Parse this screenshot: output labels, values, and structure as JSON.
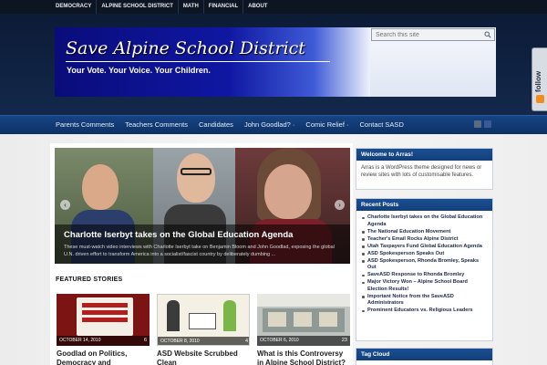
{
  "top_nav": [
    "DEMOCRACY",
    "ALPINE SCHOOL DISTRICT",
    "MATH",
    "FINANCIAL",
    "ABOUT"
  ],
  "banner": {
    "title": "Save Alpine School District",
    "subtitle": "Your Vote. Your Voice. Your Children."
  },
  "search": {
    "placeholder": "Search this site"
  },
  "follow": {
    "label": "follow"
  },
  "main_nav": [
    "Parents Comments",
    "Teachers Comments",
    "Candidates",
    "John Goodlad? ·",
    "Comic Relief ·",
    "Contact SASD"
  ],
  "slider": {
    "title": "Charlotte Iserbyt takes on the Global Education Agenda",
    "excerpt": "These must-watch video interviews with Charlotte Iserbyt take on Benjamin Bloom and John Goodlad, exposing the global U.N. driven effort to transform America into a socialist/fascist country by deliberately dumbing ..."
  },
  "featured": {
    "heading": "FEATURED STORIES",
    "cards": [
      {
        "title": "Goodlad on Politics, Democracy and Capitalism",
        "date": "OCTOBER 14, 2010",
        "count": "6"
      },
      {
        "title": "ASD Website Scrubbed Clean",
        "date": "OCTOBER 8, 2010",
        "count": "4"
      },
      {
        "title": "What is this Controversy in Alpine School District?",
        "date": "OCTOBER 6, 2010",
        "count": "23"
      }
    ]
  },
  "sidebar": {
    "welcome": {
      "title": "Welcome to Arras!",
      "text": "Arras is a WordPress theme designed for news or review sites with lots of customisable features."
    },
    "recent": {
      "title": "Recent Posts",
      "items": [
        "Charlotte Iserbyt takes on the Global Education Agenda",
        "The National Education Movement",
        "Teacher's Email Rocks Alpine District",
        "Utah Taxpayers Fund Global Education Agenda",
        "ASD Spokesperson Speaks Out",
        "ASD Spokesperson, Rhonda Bromley, Speaks Out",
        "SaveASD Response to Rhonda Bromley",
        "Major Victory Won – Alpine School Board Election Results!",
        "Important Notice from the SaveASD Administrators",
        "Prominent Educators vs. Religious Leaders"
      ]
    },
    "tagcloud": {
      "title": "Tag Cloud"
    }
  },
  "colors": {
    "nav_blue": "#164583",
    "banner_blue": "#0f17a2",
    "widget_header": "#1b4f92",
    "rss_orange": "#f28c1d"
  }
}
